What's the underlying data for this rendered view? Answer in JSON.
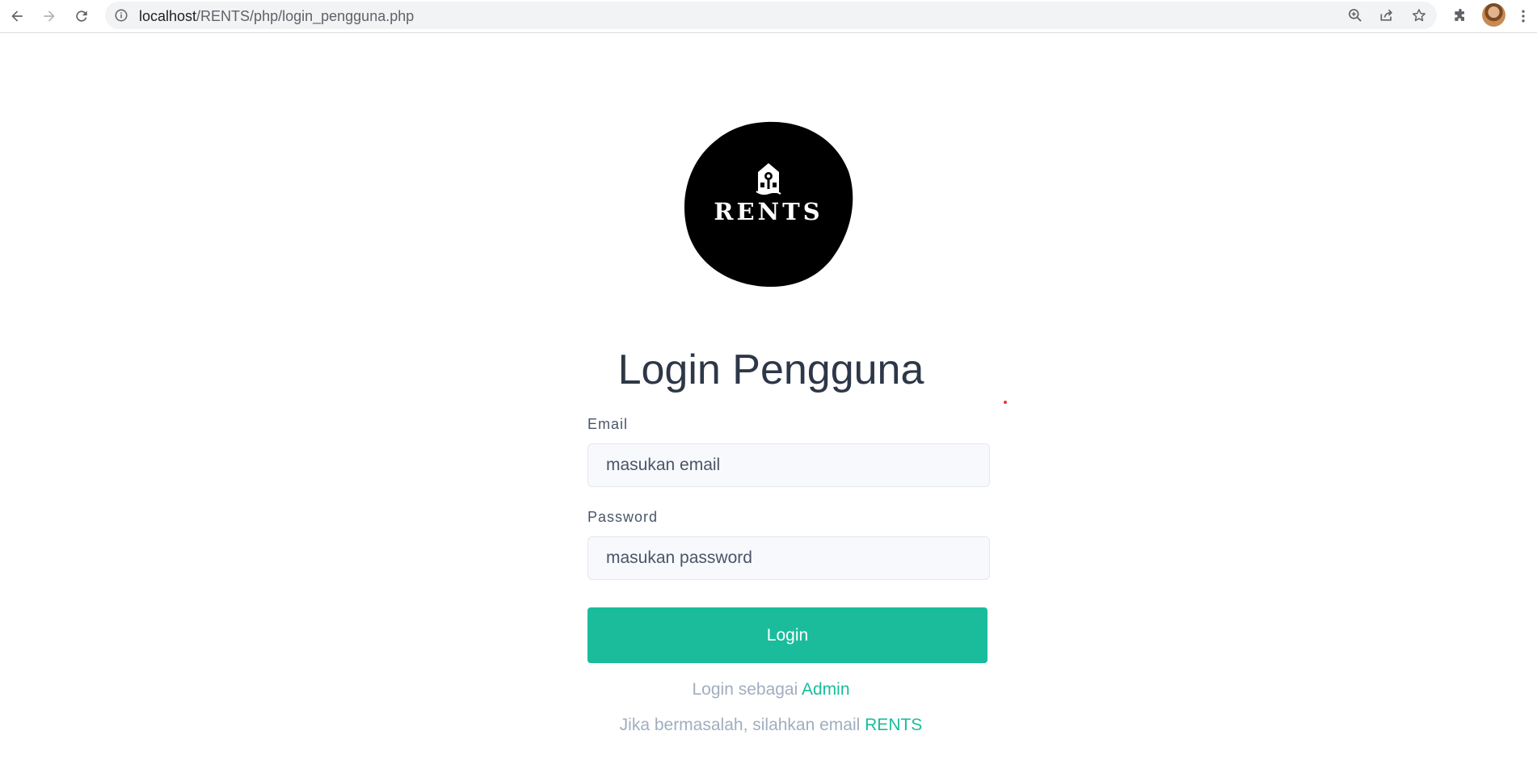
{
  "browser": {
    "url_host": "localhost",
    "url_path": "/RENTS/php/login_pengguna.php"
  },
  "logo": {
    "text": "RENTS",
    "icon": "house-key-icon"
  },
  "login": {
    "title": "Login Pengguna",
    "email_label": "Email",
    "email_placeholder": "masukan email",
    "email_value": "",
    "password_label": "Password",
    "password_placeholder": "masukan password",
    "password_value": "",
    "button_label": "Login",
    "admin_prefix": "Login sebagai ",
    "admin_link": "Admin",
    "help_prefix": "Jika bermasalah, silahkan email ",
    "help_link": "RENTS"
  },
  "colors": {
    "accent": "#1abc9c",
    "title": "#2d3748",
    "muted": "#a0aec0",
    "logo_bg": "#000000"
  }
}
